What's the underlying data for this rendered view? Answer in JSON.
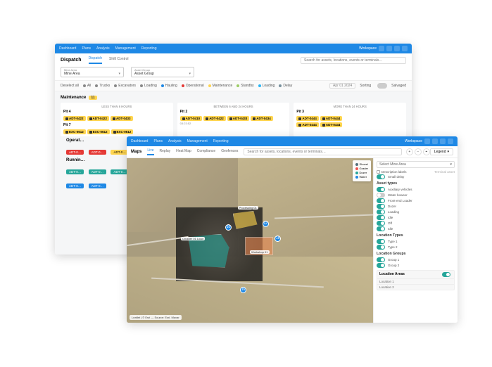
{
  "colors": {
    "primary": "#1e88e5",
    "accent": "#ffd54f",
    "teal": "#26a69a",
    "orange": "#e8864f",
    "danger": "#e53935"
  },
  "back": {
    "nav": {
      "tabs": [
        "Dashboard",
        "Plans",
        "Analysis",
        "Management",
        "Reporting"
      ],
      "workspace": "Workspace"
    },
    "sub": {
      "title": "Dispatch",
      "tabs": [
        "Dispatch",
        "Shift Control"
      ],
      "active_index": 0,
      "search_placeholder": "Search for assets, locations, events or terminals…"
    },
    "selects": [
      {
        "label": "Mine Area",
        "value": "Mine Area"
      },
      {
        "label": "Asset Group",
        "value": "Asset Group"
      }
    ],
    "filter_chips": [
      {
        "label": "Deselect all",
        "color": ""
      },
      {
        "label": "All",
        "color": "#888"
      },
      {
        "label": "Trucks",
        "color": "#888"
      },
      {
        "label": "Excavators",
        "color": "#888"
      },
      {
        "label": "Loading",
        "color": "#888"
      },
      {
        "label": "Hauling",
        "color": "#1e88e5"
      },
      {
        "label": "Operational",
        "color": "#e53935"
      },
      {
        "label": "Maintenance",
        "color": "#ffd54f"
      },
      {
        "label": "Standby",
        "color": "#9ccc65"
      },
      {
        "label": "Loading",
        "color": "#29b6f6"
      },
      {
        "label": "Delay",
        "color": "#78909c"
      }
    ],
    "filter_meta": {
      "date": "Apr 01 2024",
      "sort": "Sorting",
      "salvage": "Salvaged"
    },
    "maintenance": {
      "title": "Maintenance",
      "count": 11,
      "lanes": [
        {
          "title": "LESS THAN 6 HOURS",
          "sub": "Pit 4",
          "cards": [
            "ADT-0422",
            "ADT-0422",
            "ADT-0433"
          ],
          "row2": "Pit 7",
          "cards2": [
            "EXC-0612",
            "EXC-0612",
            "EXC-0612"
          ]
        },
        {
          "title": "BETWEEN 6 AND 24 HOURS",
          "sub": "Pit 2",
          "cards": [
            "ADT-0410",
            "ADT-0422",
            "ADT-0433",
            "ADT-0434"
          ]
        },
        {
          "title": "MORE THAN 24 HOURS",
          "sub": "Pit 3",
          "cards": [
            "ADT-0444",
            "ADT-0444"
          ],
          "cards2": [
            "ADT-0444",
            "ADT-0444"
          ]
        }
      ]
    },
    "lower": {
      "operational_title": "Operat…",
      "running_title": "Runnin…",
      "red_pills": [
        "ADT-0…",
        "ADT-0…"
      ],
      "yellow_pills": [
        "ADT-0…"
      ],
      "teal_pills": [
        "ADT-0…",
        "ADT-0…",
        "ADT-0…"
      ],
      "blue_pills": [
        "ADT-0…",
        "ADT-0…"
      ]
    }
  },
  "front": {
    "nav": {
      "tabs": [
        "Dashboard",
        "Plans",
        "Analysis",
        "Management",
        "Reporting"
      ],
      "workspace": "Workspace"
    },
    "sub": {
      "title": "Maps",
      "tabs": [
        "Live",
        "Replay",
        "Heat Map",
        "Compliance",
        "Geofences"
      ],
      "active_index": 0,
      "search_placeholder": "Search for assets, locations, events or terminals…",
      "legend_label": "Legend"
    },
    "legend_float": [
      {
        "label": "Shovel",
        "color": "#546e7a"
      },
      {
        "label": "Grader",
        "color": "#ef5350"
      },
      {
        "label": "Dozer",
        "color": "#26a69a"
      },
      {
        "label": "Water",
        "color": "#1e88e5"
      }
    ],
    "zones": {
      "green_label": "Crusher 01 Load",
      "yellow_label": "Processing 01",
      "orange_label": "Workshop 01"
    },
    "markers": [
      "10",
      "12",
      "18",
      "16"
    ],
    "scalebar": "Leaflet | © Esri — Source: Esri, Maxar",
    "side": {
      "select_label": "Select Mine Area",
      "desc_checkbox": "Description labels",
      "terminal_label": "Terminal asset",
      "small_delay": "Small delay",
      "asset_types": {
        "title": "Asset types",
        "items": [
          {
            "label": "Auxiliary vehicles",
            "on": true
          },
          {
            "label": "Water bowser",
            "on": false
          },
          {
            "label": "Front-end Loader",
            "on": true
          },
          {
            "label": "Dozer",
            "on": true
          },
          {
            "label": "Loading",
            "on": true
          },
          {
            "label": "Idle",
            "on": true
          },
          {
            "label": "Off",
            "on": true
          },
          {
            "label": "Idle",
            "on": true
          }
        ]
      },
      "location_types": {
        "title": "Location Types",
        "items": [
          {
            "label": "Type 1",
            "on": true
          },
          {
            "label": "Type 2",
            "on": true
          }
        ]
      },
      "location_groups": {
        "title": "Location Groups",
        "items": [
          {
            "label": "Group 1",
            "on": true
          },
          {
            "label": "Group 2",
            "on": true
          }
        ]
      },
      "location_areas": {
        "title": "Location Areas",
        "items": [
          "Location 1",
          "Location 2"
        ]
      }
    }
  }
}
